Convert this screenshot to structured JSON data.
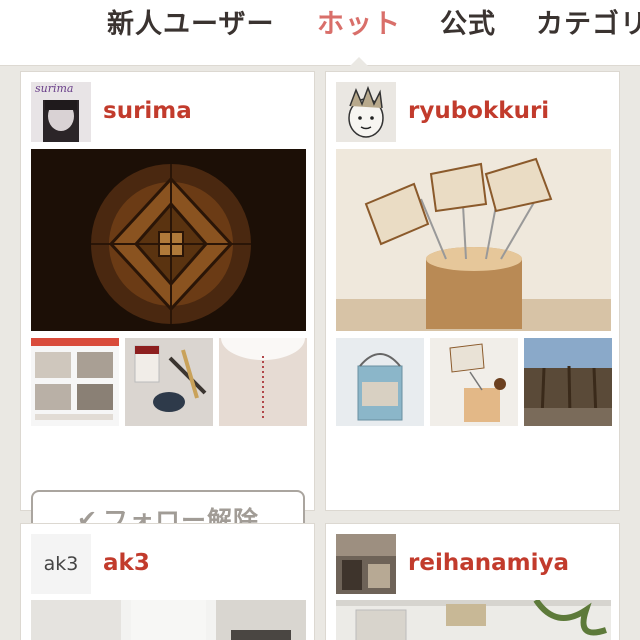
{
  "tabs": [
    {
      "label": "新人ユーザー",
      "active": false
    },
    {
      "label": "ホット",
      "active": true
    },
    {
      "label": "公式",
      "active": false
    },
    {
      "label": "カテゴリ",
      "active": false
    }
  ],
  "colors": {
    "accent_tab": "#d96f6a",
    "username": "#c23b2c",
    "background": "#eae8e3"
  },
  "cards": [
    {
      "username": "surima",
      "avatar_caption": "surima",
      "follow_button": {
        "icon": "check-icon",
        "label": "フォロー解除"
      }
    },
    {
      "username": "ryubokkuri"
    },
    {
      "username": "ak3",
      "avatar_text": "ak3"
    },
    {
      "username": "reihanamiya"
    }
  ]
}
